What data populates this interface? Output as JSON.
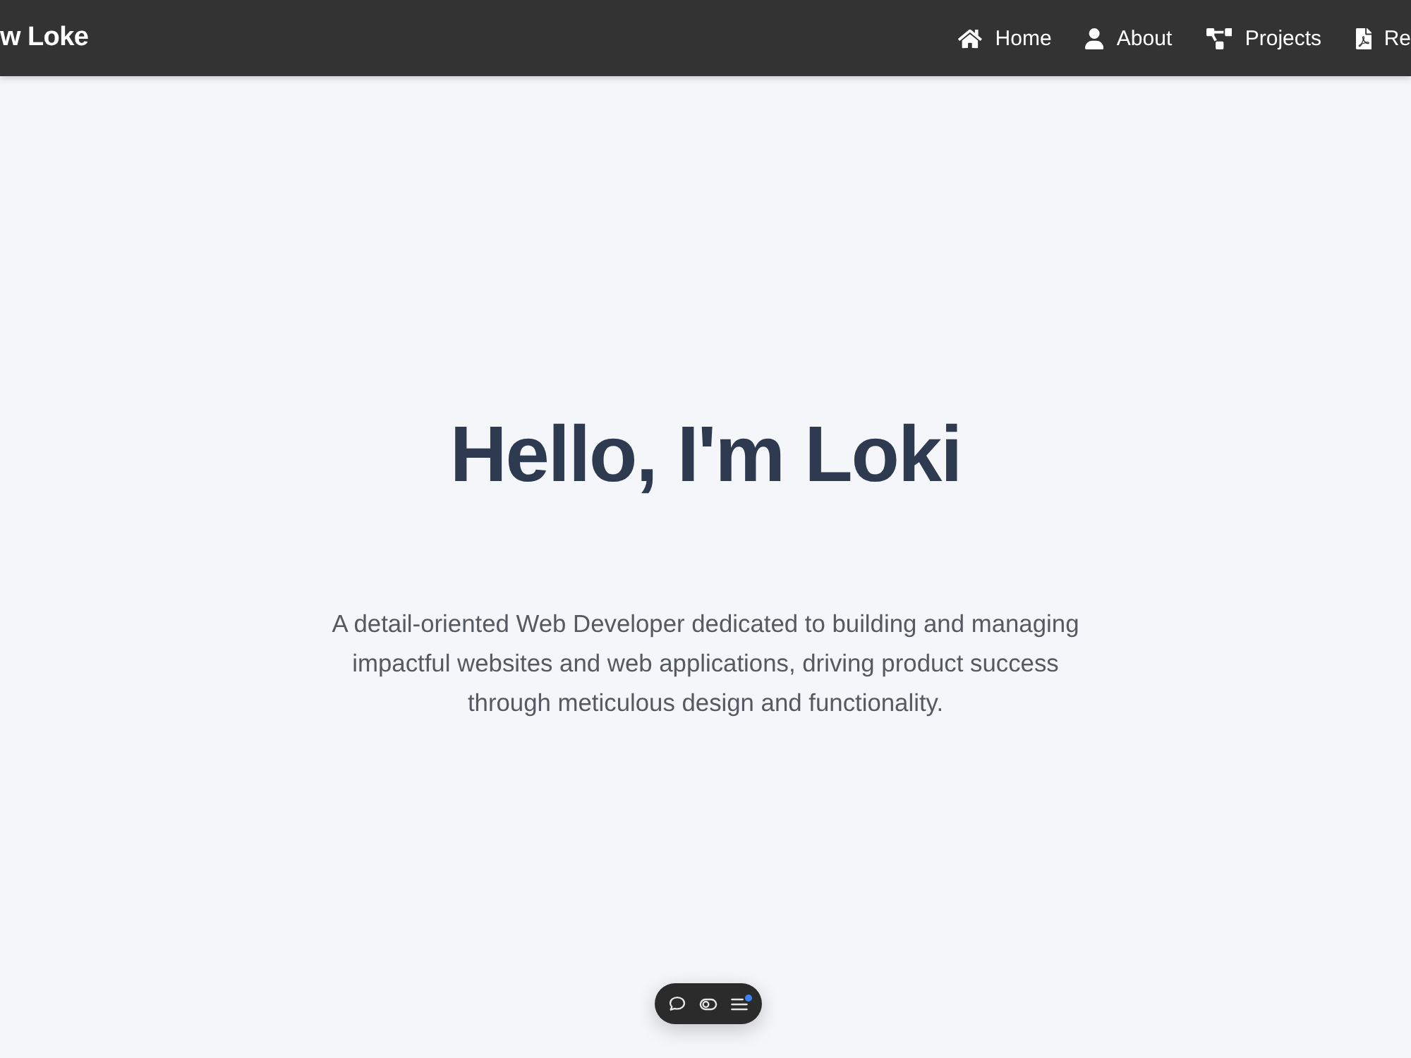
{
  "navbar": {
    "brand": "w Loke",
    "links": [
      {
        "label": "Home"
      },
      {
        "label": "About"
      },
      {
        "label": "Projects"
      },
      {
        "label": "Re"
      }
    ]
  },
  "hero": {
    "title": "Hello, I'm Loki",
    "tagline": "A detail-oriented Web Developer dedicated to building and managing impactful websites and web applications, driving product success through meticulous design and functionality."
  },
  "toolbar": {
    "buttons": [
      {
        "notification_dot": false
      },
      {
        "notification_dot": false
      },
      {
        "notification_dot": true
      }
    ]
  }
}
